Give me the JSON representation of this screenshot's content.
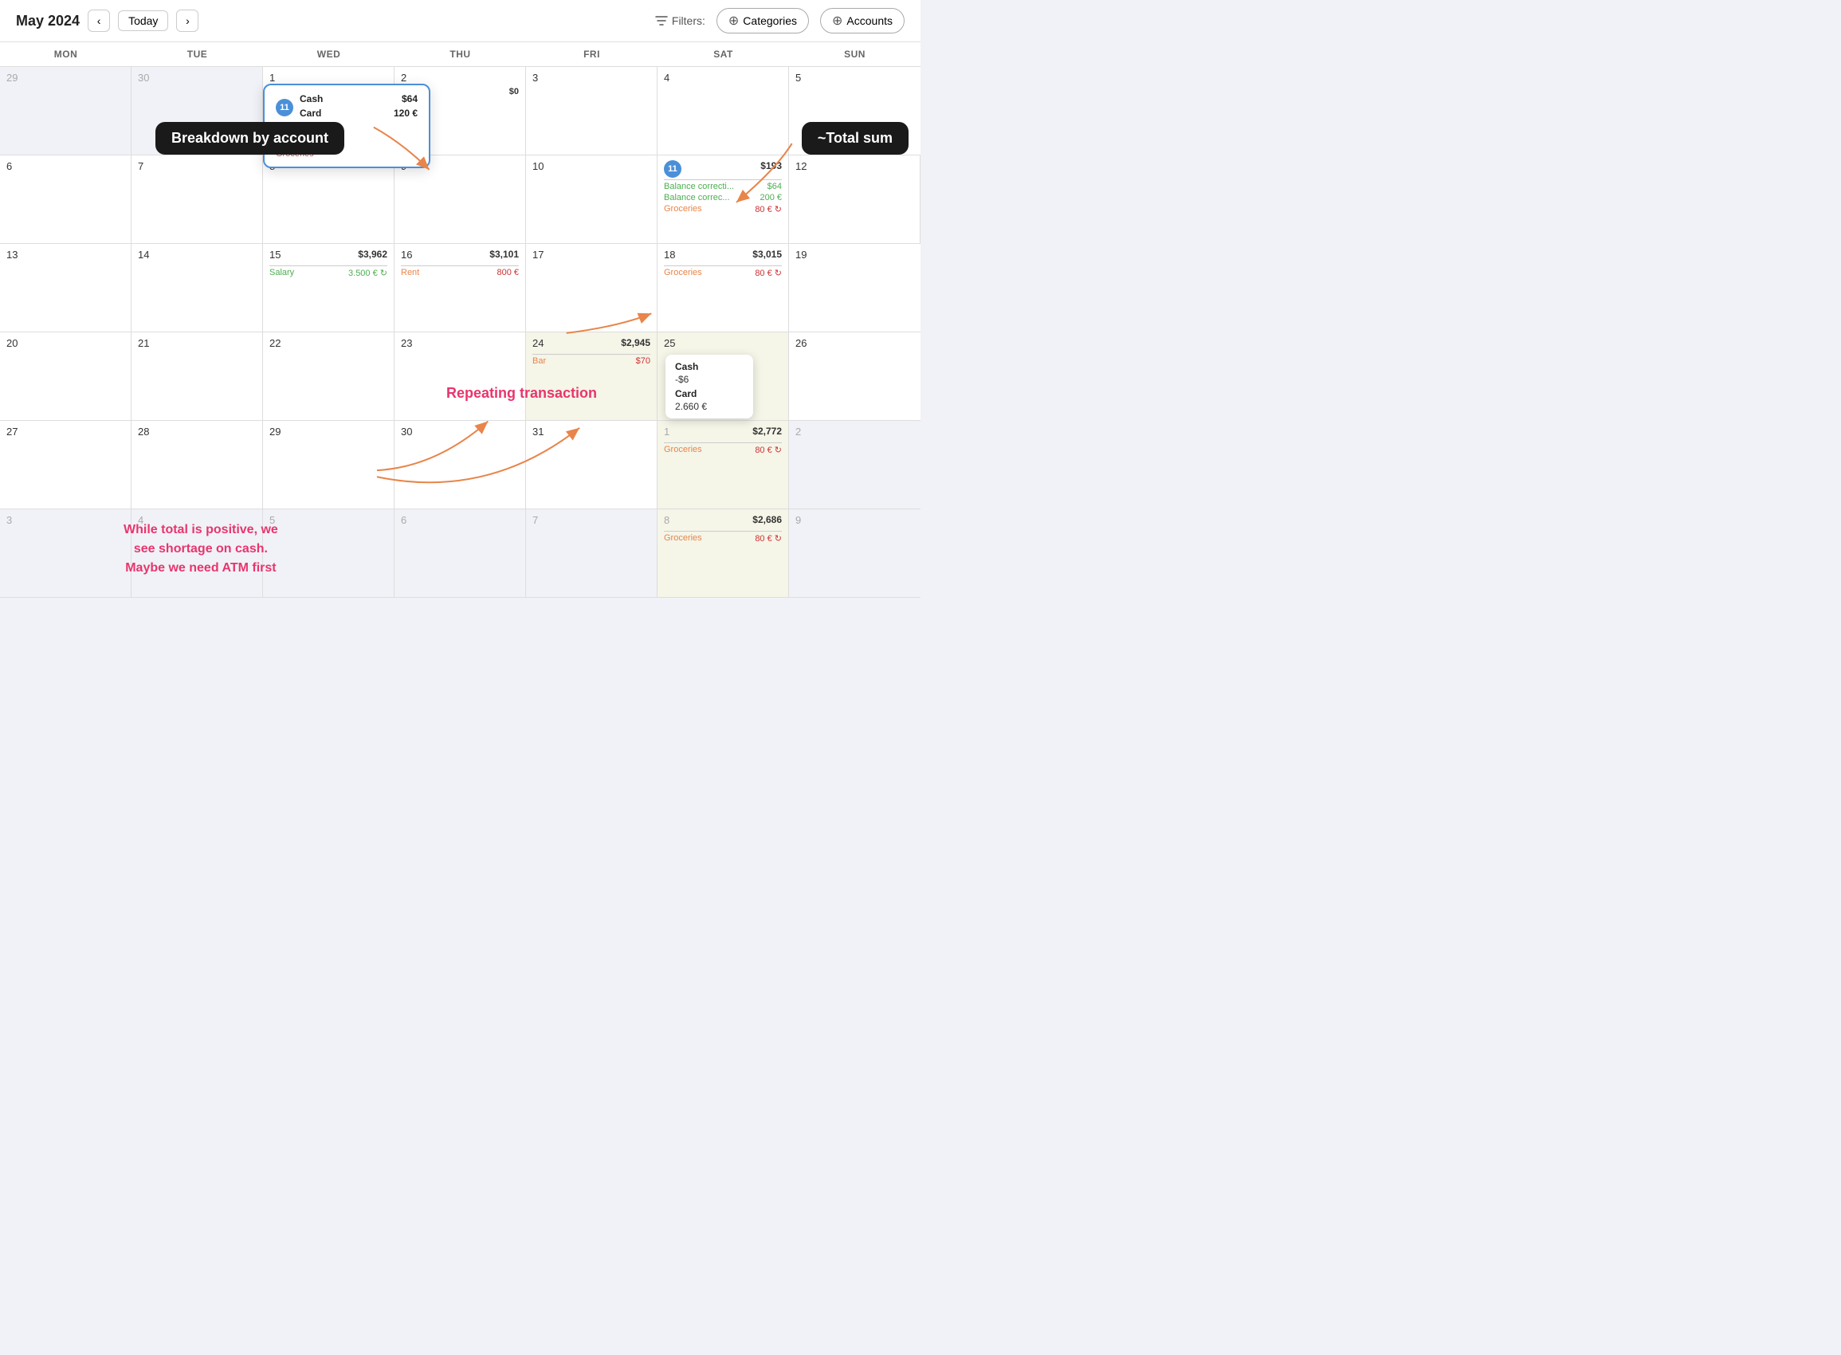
{
  "header": {
    "month_title": "May 2024",
    "today_label": "Today",
    "filters_label": "Filters:",
    "categories_label": "Categories",
    "accounts_label": "Accounts"
  },
  "day_headers": [
    "MON",
    "TUE",
    "WED",
    "THU",
    "FRI",
    "SAT",
    "SUN"
  ],
  "annotations": {
    "breakdown": "Breakdown by account",
    "total_sum": "~Total sum",
    "repeating": "Repeating transaction",
    "cash_shortage": "While total is positive, we\nsee shortage on cash.\nMaybe we need ATM first"
  },
  "weeks": [
    {
      "days": [
        {
          "date": "29",
          "other": true,
          "amount": "",
          "transactions": []
        },
        {
          "date": "30",
          "other": true,
          "amount": "",
          "transactions": []
        },
        {
          "date": "1",
          "other": false,
          "amount": "",
          "transactions": []
        },
        {
          "date": "2",
          "other": false,
          "amount": "",
          "transactions": [],
          "highlighted_box": true
        },
        {
          "date": "3",
          "other": false,
          "amount": "",
          "transactions": []
        },
        {
          "date": "4",
          "other": false,
          "amount": "",
          "transactions": []
        },
        {
          "date": "5",
          "other": false,
          "amount": "",
          "transactions": []
        }
      ]
    },
    {
      "days": [
        {
          "date": "6",
          "other": false,
          "amount": "",
          "transactions": []
        },
        {
          "date": "7",
          "other": false,
          "amount": "",
          "transactions": []
        },
        {
          "date": "8",
          "other": false,
          "amount": "",
          "transactions": []
        },
        {
          "date": "9",
          "other": false,
          "amount": "",
          "transactions": []
        },
        {
          "date": "10",
          "other": false,
          "amount": "",
          "transactions": []
        },
        {
          "date": "11",
          "other": false,
          "amount": "$193",
          "badge": "11",
          "transactions": [
            {
              "name": "Balance correcti...",
              "amount": "$64",
              "type": "green"
            },
            {
              "name": "Balance correc...",
              "amount": "200 €",
              "type": "green"
            },
            {
              "name": "Groceries",
              "amount": "80 € ↻",
              "type": "red"
            }
          ]
        },
        {
          "date": "12",
          "other": false,
          "amount": "",
          "transactions": []
        }
      ]
    },
    {
      "days": [
        {
          "date": "13",
          "other": false,
          "amount": "",
          "transactions": []
        },
        {
          "date": "14",
          "other": false,
          "amount": "",
          "transactions": []
        },
        {
          "date": "15",
          "other": false,
          "amount": "$3,962",
          "transactions": [
            {
              "name": "Salary",
              "amount": "3.500 € ↻",
              "type": "green"
            }
          ]
        },
        {
          "date": "16",
          "other": false,
          "amount": "$3,101",
          "transactions": [
            {
              "name": "Rent",
              "amount": "800 €",
              "type": "red"
            }
          ]
        },
        {
          "date": "17",
          "other": false,
          "amount": "",
          "transactions": []
        },
        {
          "date": "18",
          "other": false,
          "amount": "$3,015",
          "transactions": [
            {
              "name": "Groceries",
              "amount": "80 € ↻",
              "type": "red"
            }
          ]
        },
        {
          "date": "19",
          "other": false,
          "amount": "",
          "transactions": []
        }
      ]
    },
    {
      "days": [
        {
          "date": "20",
          "other": false,
          "amount": "",
          "transactions": []
        },
        {
          "date": "21",
          "other": false,
          "amount": "",
          "transactions": []
        },
        {
          "date": "22",
          "other": false,
          "amount": "",
          "transactions": []
        },
        {
          "date": "23",
          "other": false,
          "amount": "",
          "transactions": []
        },
        {
          "date": "24",
          "other": false,
          "amount": "$2,945",
          "highlighted": true,
          "transactions": [
            {
              "name": "Bar",
              "amount": "$70",
              "type": "red"
            }
          ]
        },
        {
          "date": "25",
          "other": false,
          "amount": "",
          "highlighted": true,
          "transactions": []
        },
        {
          "date": "26",
          "other": false,
          "amount": "",
          "transactions": []
        }
      ]
    },
    {
      "days": [
        {
          "date": "27",
          "other": false,
          "amount": "",
          "transactions": []
        },
        {
          "date": "28",
          "other": false,
          "amount": "",
          "transactions": []
        },
        {
          "date": "29",
          "other": false,
          "amount": "",
          "transactions": []
        },
        {
          "date": "30",
          "other": false,
          "amount": "",
          "transactions": []
        },
        {
          "date": "31",
          "other": false,
          "amount": "",
          "transactions": []
        },
        {
          "date": "1",
          "other": true,
          "amount": "$2,772",
          "highlighted": true,
          "transactions": [
            {
              "name": "Groceries",
              "amount": "80 € ↻",
              "type": "red"
            }
          ]
        },
        {
          "date": "2",
          "other": true,
          "amount": "",
          "transactions": []
        }
      ]
    },
    {
      "days": [
        {
          "date": "3",
          "other": true,
          "amount": "",
          "transactions": []
        },
        {
          "date": "4",
          "other": true,
          "amount": "",
          "transactions": []
        },
        {
          "date": "5",
          "other": true,
          "amount": "",
          "transactions": []
        },
        {
          "date": "6",
          "other": true,
          "amount": "",
          "transactions": []
        },
        {
          "date": "7",
          "other": true,
          "amount": "",
          "transactions": []
        },
        {
          "date": "8",
          "other": true,
          "amount": "$2,686",
          "highlighted": true,
          "transactions": [
            {
              "name": "Groceries",
              "amount": "80 € ↻",
              "type": "red"
            }
          ]
        },
        {
          "date": "9",
          "other": true,
          "amount": "",
          "transactions": []
        }
      ]
    }
  ],
  "tooltip_breakdown": {
    "badge": "11",
    "cash_label": "Cash",
    "cash_amount": "$64",
    "card_label": "Card",
    "card_amount": "120 €",
    "transactions": [
      {
        "name": "Balance correc...",
        "type": "green"
      },
      {
        "name": "Balance correc...",
        "type": "green"
      },
      {
        "name": "Groceries",
        "type": "red"
      }
    ]
  },
  "tooltip_cash_day25": {
    "cash_label": "Cash",
    "cash_amount": "-$6",
    "card_label": "Card",
    "card_amount": "2.660 €"
  },
  "week2_day3_partial": {
    "amount_partial": "$0",
    "lines": [
      {
        "text": "0",
        "color": "normal"
      },
      {
        "text": "€",
        "color": "normal"
      }
    ]
  }
}
